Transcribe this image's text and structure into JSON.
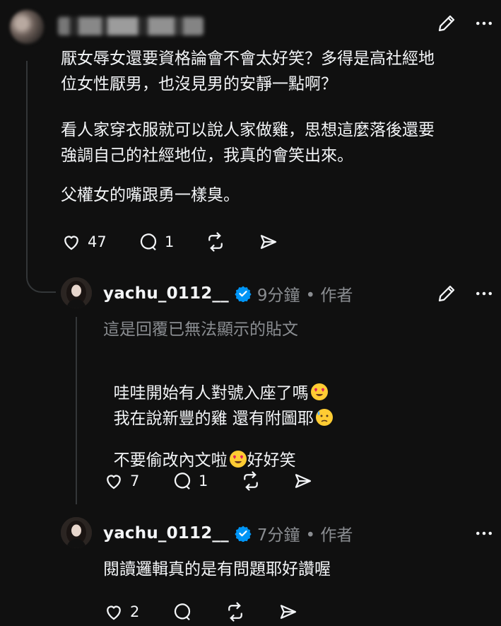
{
  "post": {
    "paragraphs": [
      "厭女辱女還要資格論會不會太好笑？多得是高社經地\n位女性厭男，也沒見男的安靜一點啊？",
      "看人家穿衣服就可以說人家做雞，思想這麼落後還要\n強調自己的社經地位，我真的會笑出來。",
      "父權女的嘴跟勇一樣臭。"
    ],
    "likes": "47",
    "replies": "1"
  },
  "reply1": {
    "username": "yachu_0112__",
    "time": "9分鐘",
    "role": "• 作者",
    "quoted_notice": "這是回覆已無法顯示的貼文",
    "line1": "哇哇開始有人對號入座了嗎",
    "line2": "我在說新豐的雞 還有附圖耶",
    "line3a": "不要偷改內文啦",
    "line3b": "好好笑",
    "likes": "7",
    "replies": "1"
  },
  "reply2": {
    "username": "yachu_0112__",
    "time": "7分鐘",
    "role": "• 作者",
    "text": "閱讀邏輯真的是有問題耶好讚喔",
    "likes": "2"
  },
  "icons": {
    "edit": "pencil-icon",
    "more": "more-dots-icon",
    "like": "heart-icon",
    "reply": "comment-icon",
    "repost": "repost-icon",
    "share": "send-icon",
    "verified": "verified-badge-icon"
  },
  "colors": {
    "background": "#101010",
    "text": "#f3f5f7",
    "muted": "#8a8d91",
    "verified": "#0095f6"
  }
}
